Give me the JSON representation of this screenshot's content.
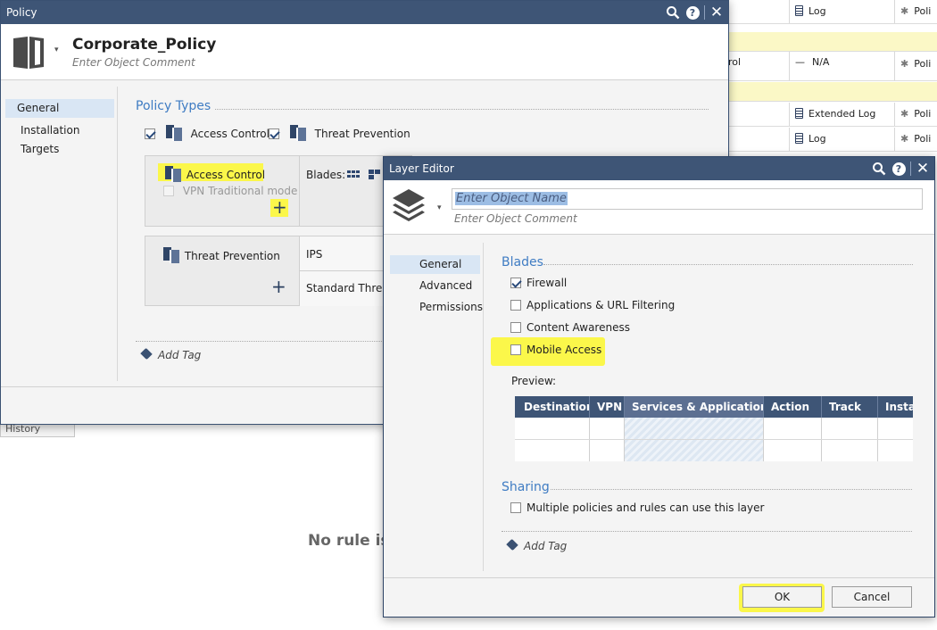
{
  "background": {
    "rows": [
      {
        "col1": "Log",
        "col2": "Poli"
      },
      {
        "col1": "N/A",
        "col0": "rol",
        "col2": "Poli"
      },
      {
        "col1": "Extended Log",
        "col2": "Poli"
      },
      {
        "col1": "Log",
        "col2": "Poli"
      }
    ],
    "history_tab": "History",
    "empty_message": "No rule is"
  },
  "policy_window": {
    "title": "Policy",
    "name": "Corporate_Policy",
    "comment_placeholder": "Enter Object Comment",
    "nav": [
      {
        "label": "General"
      },
      {
        "label": "Installation Targets"
      }
    ],
    "section_title": "Policy Types",
    "types": [
      {
        "label": "Access Control",
        "checked": true
      },
      {
        "label": "Threat Prevention",
        "checked": true
      }
    ],
    "access_control": {
      "label": "Access Control",
      "vpn_label": "VPN Traditional mode",
      "blades_label": "Blades:",
      "add_symbol": "+"
    },
    "threat_prevention": {
      "label": "Threat Prevention",
      "rows": [
        "IPS",
        "Standard Threat"
      ],
      "add_symbol": "+"
    },
    "add_tag": "Add Tag"
  },
  "layer_editor": {
    "title": "Layer Editor",
    "name_placeholder": "Enter Object Name",
    "comment_placeholder": "Enter Object Comment",
    "nav": [
      {
        "label": "General"
      },
      {
        "label": "Advanced"
      },
      {
        "label": "Permissions"
      }
    ],
    "blades_title": "Blades",
    "blades": [
      {
        "label": "Firewall",
        "checked": true
      },
      {
        "label": "Applications & URL Filtering",
        "checked": false
      },
      {
        "label": "Content Awareness",
        "checked": false
      },
      {
        "label": "Mobile Access",
        "checked": false
      }
    ],
    "preview_label": "Preview:",
    "preview_columns": [
      "Destination",
      "VPN",
      "Services & Applications",
      "Action",
      "Track",
      "Instal"
    ],
    "sharing_title": "Sharing",
    "sharing_label": "Multiple policies and rules can use this layer",
    "add_tag": "Add Tag",
    "ok": "OK",
    "cancel": "Cancel"
  },
  "colors": {
    "titlebar": "#3e5576",
    "accent_blue": "#3f7cc3",
    "highlight": "#fbf74a",
    "nav_active": "#d9e6f4"
  }
}
